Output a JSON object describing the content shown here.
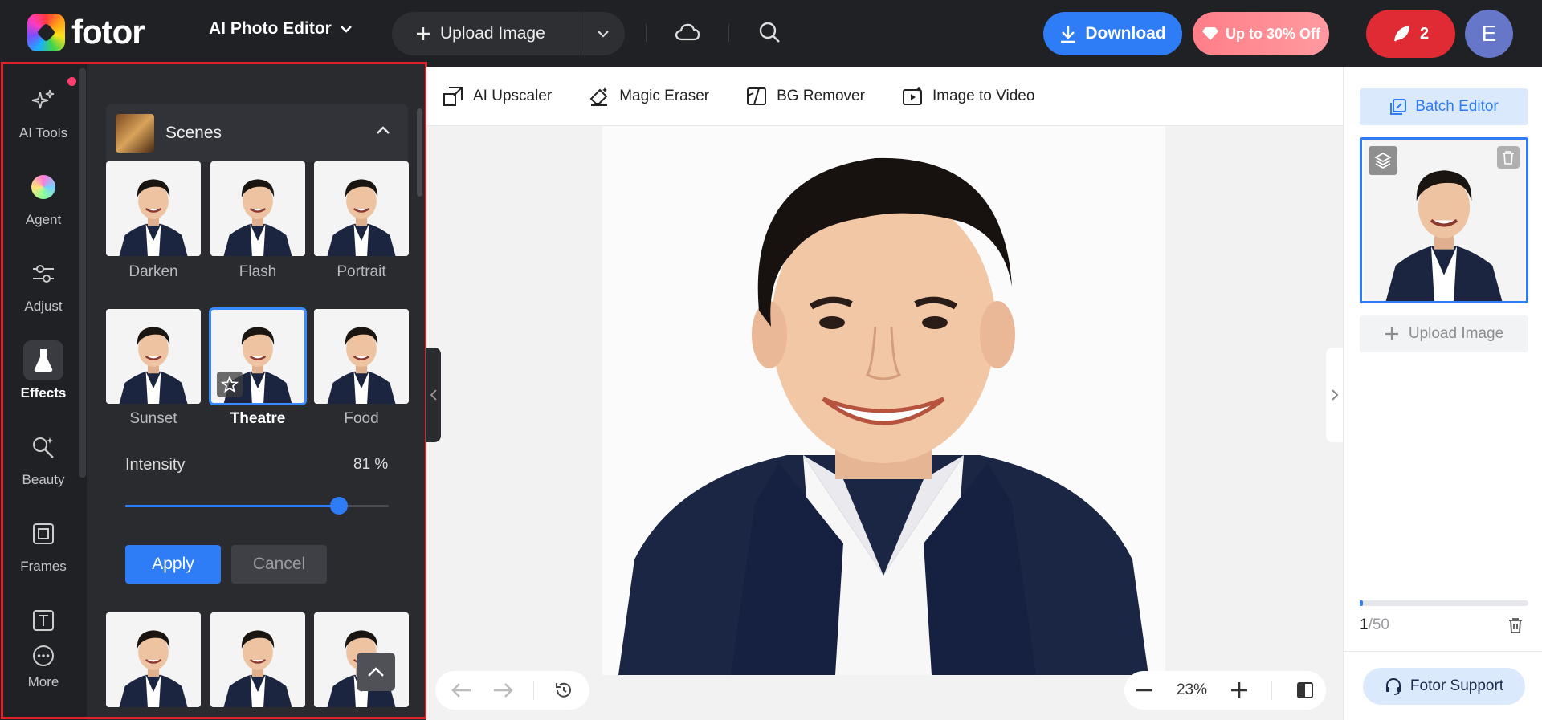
{
  "header": {
    "logo_text": "fotor",
    "editor_switch": "AI Photo Editor",
    "upload_label": "Upload Image",
    "download_label": "Download",
    "offer_label": "Up to 30% Off",
    "credits": "2",
    "avatar_initial": "E"
  },
  "rail": {
    "items": [
      {
        "label": "AI Tools",
        "icon": "sparkle-icon"
      },
      {
        "label": "Agent",
        "icon": "orb-icon"
      },
      {
        "label": "Adjust",
        "icon": "sliders-icon"
      },
      {
        "label": "Effects",
        "icon": "flask-icon"
      },
      {
        "label": "Beauty",
        "icon": "makeup-brush-icon"
      },
      {
        "label": "Frames",
        "icon": "frame-icon"
      },
      {
        "label": "More",
        "icon": "text-icon"
      }
    ],
    "active": "Effects"
  },
  "effects": {
    "section_title": "Scenes",
    "row1": [
      "Darken",
      "Flash",
      "Portrait"
    ],
    "row2": [
      "Sunset",
      "Theatre",
      "Food"
    ],
    "selected": "Theatre",
    "intensity_label": "Intensity",
    "intensity_value": "81 %",
    "intensity_fraction": 0.81,
    "apply_label": "Apply",
    "cancel_label": "Cancel"
  },
  "tools": {
    "items": [
      "AI Upscaler",
      "Magic Eraser",
      "BG Remover",
      "Image to Video"
    ]
  },
  "canvas": {
    "zoom": "23%"
  },
  "right": {
    "batch_label": "Batch Editor",
    "upload_label": "Upload Image",
    "count_current": "1",
    "count_total": "/50",
    "progress_fraction": 0.02,
    "support_label": "Fotor Support"
  },
  "colors": {
    "accent": "#2f7df6",
    "highlight_frame": "#e52228",
    "credits_bg": "#e02b35"
  }
}
